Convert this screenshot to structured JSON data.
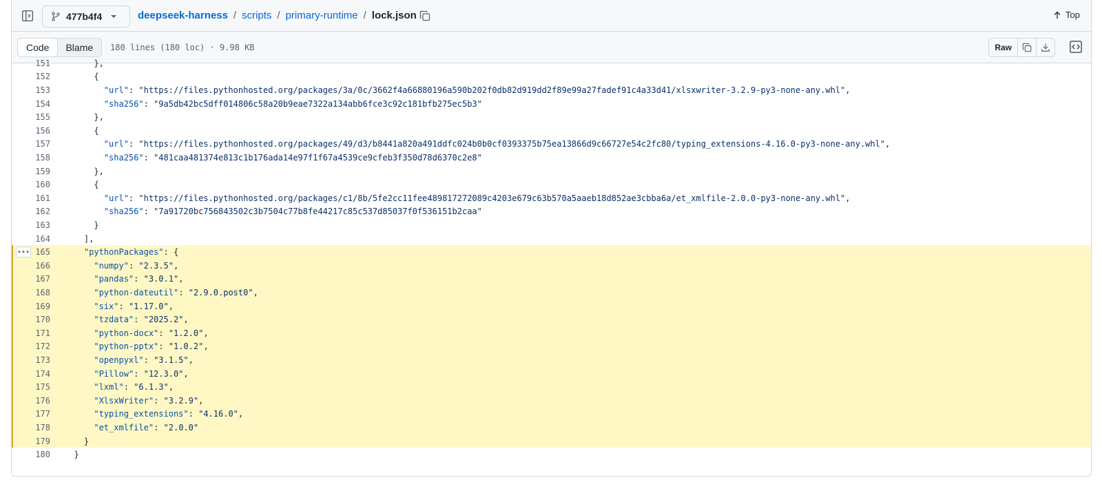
{
  "header": {
    "branch": "477b4f4",
    "breadcrumb": {
      "repo": "deepseek-harness",
      "dir1": "scripts",
      "dir2": "primary-runtime",
      "file": "lock.json",
      "separator": "/"
    },
    "top_label": "Top"
  },
  "toolbar": {
    "tab_code": "Code",
    "tab_blame": "Blame",
    "file_info": "180 lines (180 loc) · 9.98 KB",
    "raw_label": "Raw"
  },
  "highlight": {
    "from": 165,
    "to": 179
  },
  "lines": [
    {
      "n": "151",
      "t": "      },"
    },
    {
      "n": "152",
      "t": "      {"
    },
    {
      "n": "153",
      "t": "        \"url\": \"https://files.pythonhosted.org/packages/3a/0c/3662f4a66880196a590b202f0db82d919dd2f89e99a27fadef91c4a33d41/xlsxwriter-3.2.9-py3-none-any.whl\","
    },
    {
      "n": "154",
      "t": "        \"sha256\": \"9a5db42bc5dff014806c58a20b9eae7322a134abb6fce3c92c181bfb275ec5b3\""
    },
    {
      "n": "155",
      "t": "      },"
    },
    {
      "n": "156",
      "t": "      {"
    },
    {
      "n": "157",
      "t": "        \"url\": \"https://files.pythonhosted.org/packages/49/d3/b8441a820a491ddfc024b0b0cf0393375b75ea13866d9c66727e54c2fc80/typing_extensions-4.16.0-py3-none-any.whl\","
    },
    {
      "n": "158",
      "t": "        \"sha256\": \"481caa481374e813c1b176ada14e97f1f67a4539ce9cfeb3f350d78d6370c2e8\""
    },
    {
      "n": "159",
      "t": "      },"
    },
    {
      "n": "160",
      "t": "      {"
    },
    {
      "n": "161",
      "t": "        \"url\": \"https://files.pythonhosted.org/packages/c1/8b/5fe2cc11fee489817272089c4203e679c63b570a5aaeb18d852ae3cbba6a/et_xmlfile-2.0.0-py3-none-any.whl\","
    },
    {
      "n": "162",
      "t": "        \"sha256\": \"7a91720bc756843502c3b7504c77b8fe44217c85c537d85037f0f536151b2caa\""
    },
    {
      "n": "163",
      "t": "      }"
    },
    {
      "n": "164",
      "t": "    ],"
    },
    {
      "n": "165",
      "t": "    \"pythonPackages\": {"
    },
    {
      "n": "166",
      "t": "      \"numpy\": \"2.3.5\","
    },
    {
      "n": "167",
      "t": "      \"pandas\": \"3.0.1\","
    },
    {
      "n": "168",
      "t": "      \"python-dateutil\": \"2.9.0.post0\","
    },
    {
      "n": "169",
      "t": "      \"six\": \"1.17.0\","
    },
    {
      "n": "170",
      "t": "      \"tzdata\": \"2025.2\","
    },
    {
      "n": "171",
      "t": "      \"python-docx\": \"1.2.0\","
    },
    {
      "n": "172",
      "t": "      \"python-pptx\": \"1.0.2\","
    },
    {
      "n": "173",
      "t": "      \"openpyxl\": \"3.1.5\","
    },
    {
      "n": "174",
      "t": "      \"Pillow\": \"12.3.0\","
    },
    {
      "n": "175",
      "t": "      \"lxml\": \"6.1.3\","
    },
    {
      "n": "176",
      "t": "      \"XlsxWriter\": \"3.2.9\","
    },
    {
      "n": "177",
      "t": "      \"typing_extensions\": \"4.16.0\","
    },
    {
      "n": "178",
      "t": "      \"et_xmlfile\": \"2.0.0\""
    },
    {
      "n": "179",
      "t": "    }"
    },
    {
      "n": "180",
      "t": "  }"
    }
  ],
  "colors": {
    "key": "#0550ae",
    "string": "#0a3069",
    "highlight_bg": "#fff8c5",
    "highlight_bar": "#d4a72c",
    "link": "#0969da"
  },
  "icons": [
    "sidebar-toggle-icon",
    "git-branch-icon",
    "chevron-down-icon",
    "copy-icon",
    "arrow-up-icon",
    "download-icon",
    "code-square-icon",
    "kebab-horizontal-icon"
  ]
}
